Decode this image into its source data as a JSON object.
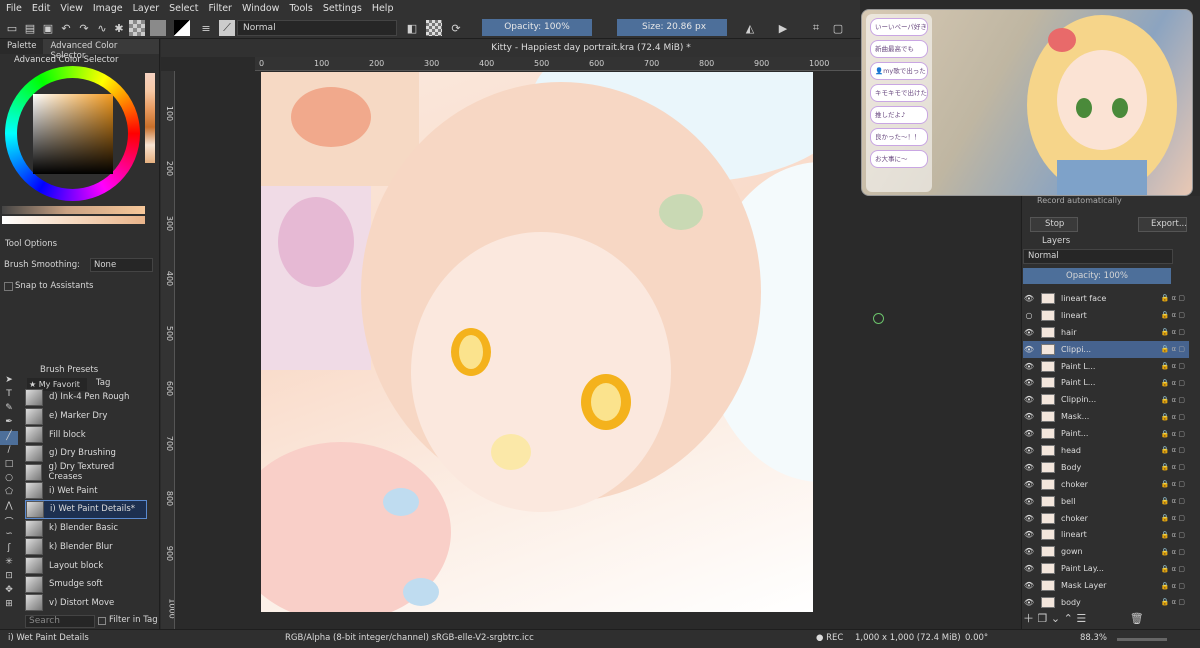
{
  "menu": [
    "File",
    "Edit",
    "View",
    "Image",
    "Layer",
    "Select",
    "Filter",
    "Window",
    "Tools",
    "Settings",
    "Help"
  ],
  "toolbar": {
    "blend_mode": "Normal",
    "opacity": "Opacity: 100%",
    "size": "Size: 20.86 px"
  },
  "document": {
    "title": "Kitty - Happiest day portrait.kra (72.4 MiB) *"
  },
  "left_dock": {
    "tabs": [
      "Palette",
      "Advanced Color Selector"
    ],
    "color_selector_title": "Advanced Color Selector",
    "tool_options_title": "Tool Options",
    "brush_smoothing_label": "Brush Smoothing:",
    "brush_smoothing_value": "None",
    "snap_label": "Snap to Assistants",
    "brush_presets_title": "Brush Presets",
    "filter_value": "★ My Favorit",
    "tag_label": "Tag",
    "search_placeholder": "Search",
    "filter_in_tag": "Filter in Tag",
    "brushes": [
      "d) Ink-4 Pen Rough",
      "e) Marker Dry",
      "Fill block",
      "g) Dry Brushing",
      "g) Dry Textured Creases",
      "i) Wet Paint",
      "i) Wet Paint Details*",
      "k) Blender Basic",
      "k) Blender Blur",
      "Layout block",
      "Smudge soft",
      "v) Distort Move"
    ],
    "selected_brush_index": 6
  },
  "ruler": {
    "h": [
      "0",
      "100",
      "200",
      "300",
      "400",
      "500",
      "600",
      "700",
      "800",
      "900",
      "1000"
    ],
    "v": [
      "100",
      "200",
      "300",
      "400",
      "500",
      "600",
      "700",
      "800",
      "900",
      "1000"
    ]
  },
  "right_dock": {
    "record_auto": "Record automatically",
    "stop": "Stop",
    "export": "Export...",
    "layers_title": "Layers",
    "blend": "Normal",
    "opacity": "Opacity:  100%",
    "layers": [
      {
        "name": "lineart face",
        "visible": true
      },
      {
        "name": "lineart",
        "visible": false
      },
      {
        "name": "hair",
        "visible": true
      },
      {
        "name": "Clippi...",
        "visible": true,
        "selected": true
      },
      {
        "name": "Paint L...",
        "visible": true
      },
      {
        "name": "Paint L...",
        "visible": true
      },
      {
        "name": "Clippin...",
        "visible": true
      },
      {
        "name": "Mask...",
        "visible": true
      },
      {
        "name": "Paint...",
        "visible": true
      },
      {
        "name": "head",
        "visible": true
      },
      {
        "name": "Body",
        "visible": true
      },
      {
        "name": "choker",
        "visible": true
      },
      {
        "name": "bell",
        "visible": true
      },
      {
        "name": "choker",
        "visible": true
      },
      {
        "name": "lineart",
        "visible": true
      },
      {
        "name": "gown",
        "visible": true
      },
      {
        "name": "Paint Lay...",
        "visible": true
      },
      {
        "name": "Mask Layer",
        "visible": true
      },
      {
        "name": "body",
        "visible": true
      }
    ]
  },
  "overlay_chat": [
    "いーいペーパ好き",
    "新曲最高でも",
    "👤my歌で出った",
    "キモキモで出けた",
    "推しだよ♪",
    "良かった～！！",
    "お大事に～"
  ],
  "status": {
    "brush": "i) Wet Paint Details",
    "colorspace": "RGB/Alpha (8-bit integer/channel)  sRGB-elle-V2-srgbtrc.icc",
    "rec": "● REC",
    "dims": "1,000 x 1,000 (72.4 MiB)",
    "rotation": "0.00°",
    "zoom": "88.3%"
  }
}
